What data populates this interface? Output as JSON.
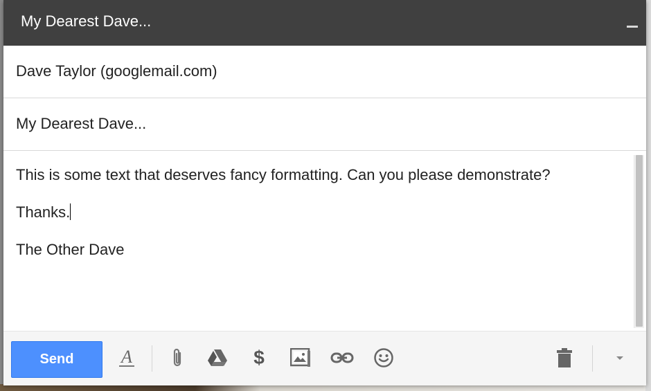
{
  "window": {
    "title": "My Dearest Dave...",
    "minimize_icon": "minimize-icon"
  },
  "compose": {
    "to_value": "Dave Taylor (googlemail.com)",
    "subject_value": "My Dearest Dave...",
    "body_lines": [
      "This is some text that deserves fancy formatting. Can you please demonstrate?",
      "Thanks.",
      "The Other Dave"
    ]
  },
  "toolbar": {
    "send_label": "Send",
    "format_glyph": "A",
    "dollar_glyph": "$",
    "icons": [
      "format-text-icon",
      "attach-icon",
      "drive-icon",
      "money-icon",
      "photo-icon",
      "link-icon",
      "emoji-icon",
      "trash-icon",
      "more-options-icon"
    ]
  },
  "colors": {
    "titlebar": "#404040",
    "send_button": "#4d90fe",
    "text": "#222222"
  }
}
